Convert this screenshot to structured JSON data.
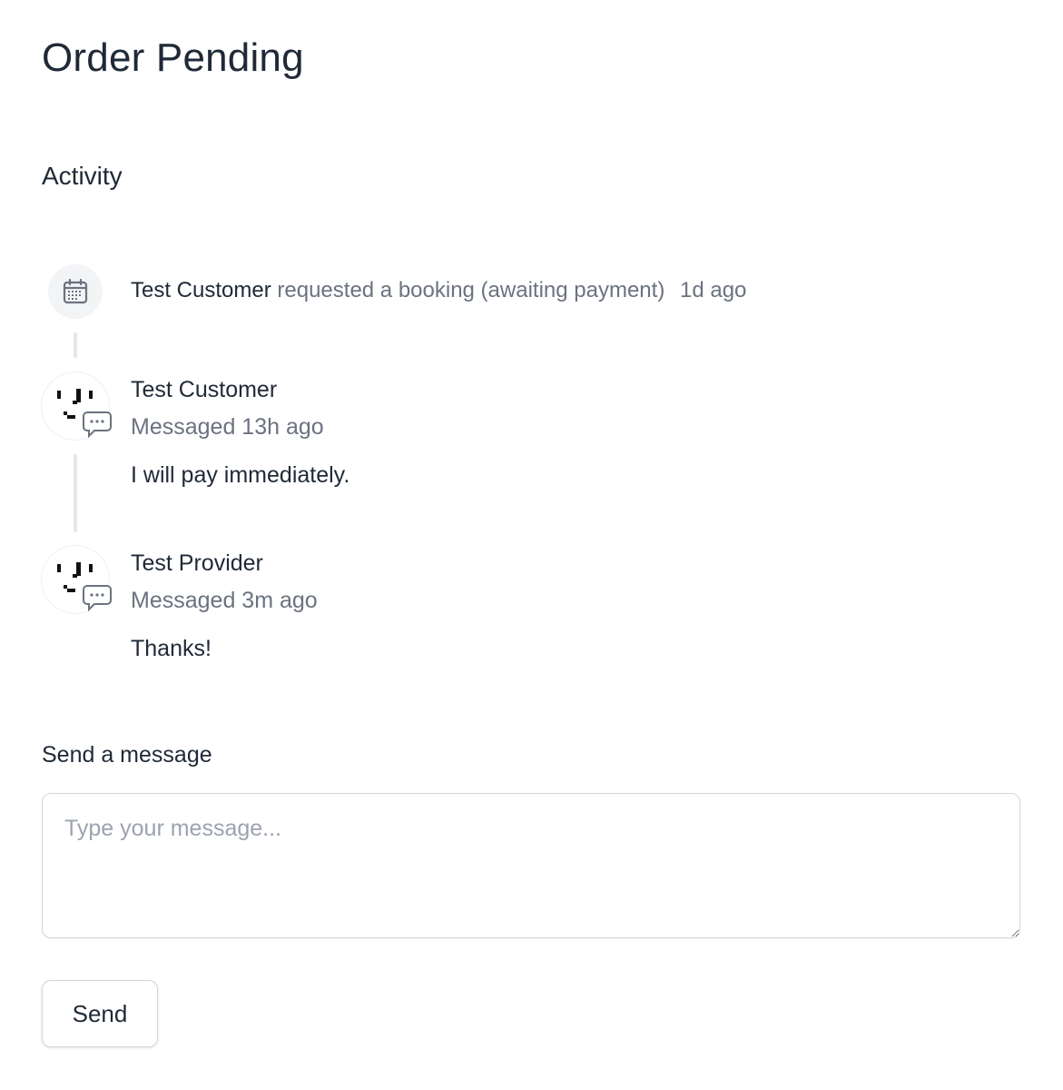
{
  "page": {
    "title": "Order Pending"
  },
  "activity": {
    "heading": "Activity",
    "booking_event": {
      "actor": "Test Customer",
      "description": "requested a booking (awaiting payment)",
      "time": "1d ago",
      "icon": "calendar-icon"
    },
    "messages": [
      {
        "author": "Test Customer",
        "meta": "Messaged 13h ago",
        "body": "I will pay immediately.",
        "icon": "chat-bubble-icon"
      },
      {
        "author": "Test Provider",
        "meta": "Messaged 3m ago",
        "body": "Thanks!",
        "icon": "chat-bubble-icon"
      }
    ]
  },
  "compose": {
    "label": "Send a message",
    "placeholder": "Type your message...",
    "value": "",
    "send_label": "Send"
  },
  "colors": {
    "text_primary": "#1f2937",
    "text_secondary": "#6b7280",
    "border": "#d1d5db",
    "icon_bg": "#f3f4f6"
  }
}
